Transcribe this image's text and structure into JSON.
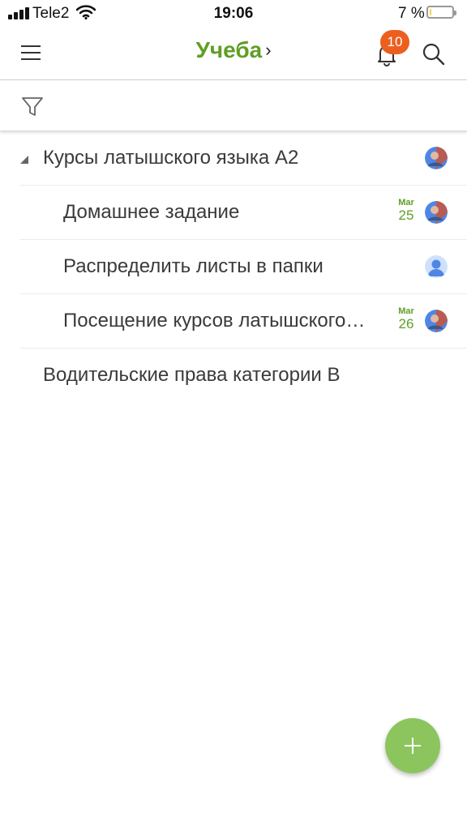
{
  "colors": {
    "accent": "#5f9e24",
    "badge": "#ec5f1e",
    "fab": "#8cc55e",
    "battery_fill": "#f5d442",
    "avatar_blue": "#4f86e6"
  },
  "status_bar": {
    "carrier": "Tele2",
    "time": "19:06",
    "battery_percent": "7 %",
    "battery_level": 0.07,
    "icons": [
      "signal-icon",
      "wifi-icon",
      "battery-icon"
    ]
  },
  "header": {
    "title": "Учеба",
    "chevron": "›",
    "notification_count": "10",
    "icons": [
      "hamburger-menu-icon",
      "bell-icon",
      "search-icon"
    ]
  },
  "filter": {
    "icon": "filter-icon"
  },
  "projects": [
    {
      "title": "Курсы латышского языка А2",
      "expanded": true,
      "avatar": "photo",
      "tasks": [
        {
          "title": "Домашнее задание",
          "date_month": "Mar",
          "date_day": "25",
          "avatar": "photo"
        },
        {
          "title": "Распределить листы в папки",
          "date_month": "",
          "date_day": "",
          "avatar": "placeholder"
        },
        {
          "title": "Посещение курсов латышского…",
          "date_month": "Mar",
          "date_day": "26",
          "avatar": "photo"
        }
      ]
    },
    {
      "title": "Водительские права категории B"
    }
  ],
  "fab": {
    "label": "+",
    "icon": "plus-icon"
  }
}
